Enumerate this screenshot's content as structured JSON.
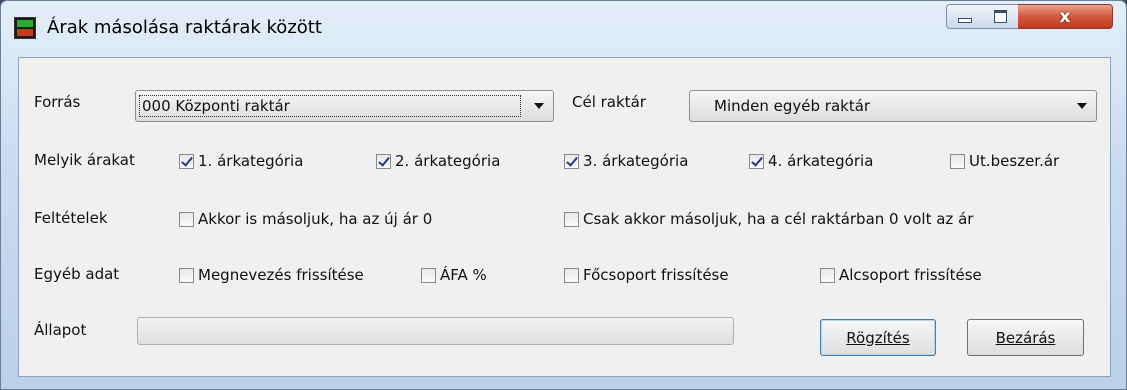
{
  "window": {
    "title": "Árak másolása raktárak között",
    "icon": "app-icon",
    "close_glyph": "x"
  },
  "form": {
    "source": {
      "label": "Forrás",
      "value": "000 Központi raktár"
    },
    "target": {
      "label": "Cél raktár",
      "value": "Minden egyéb raktár"
    },
    "prices": {
      "label": "Melyik árakat",
      "options": [
        {
          "label": "1. árkategória",
          "checked": true
        },
        {
          "label": "2. árkategória",
          "checked": true
        },
        {
          "label": "3. árkategória",
          "checked": true
        },
        {
          "label": "4. árkategória",
          "checked": true
        },
        {
          "label": "Ut.beszer.ár",
          "checked": false
        }
      ]
    },
    "conditions": {
      "label": "Feltételek",
      "options": [
        {
          "label": "Akkor is másoljuk, ha az új ár 0",
          "checked": false
        },
        {
          "label": "Csak akkor másoljuk, ha a cél raktárban 0 volt az ár",
          "checked": false
        }
      ]
    },
    "other": {
      "label": "Egyéb adat",
      "options": [
        {
          "label": "Megnevezés frissítése",
          "checked": false
        },
        {
          "label": "ÁFA %",
          "checked": false
        },
        {
          "label": "Főcsoport frissítése",
          "checked": false
        },
        {
          "label": "Alcsoport frissítése",
          "checked": false
        }
      ]
    },
    "status": {
      "label": "Állapot",
      "progress": 0
    },
    "buttons": {
      "save": "Rögzítés",
      "close": "Bezárás"
    }
  }
}
